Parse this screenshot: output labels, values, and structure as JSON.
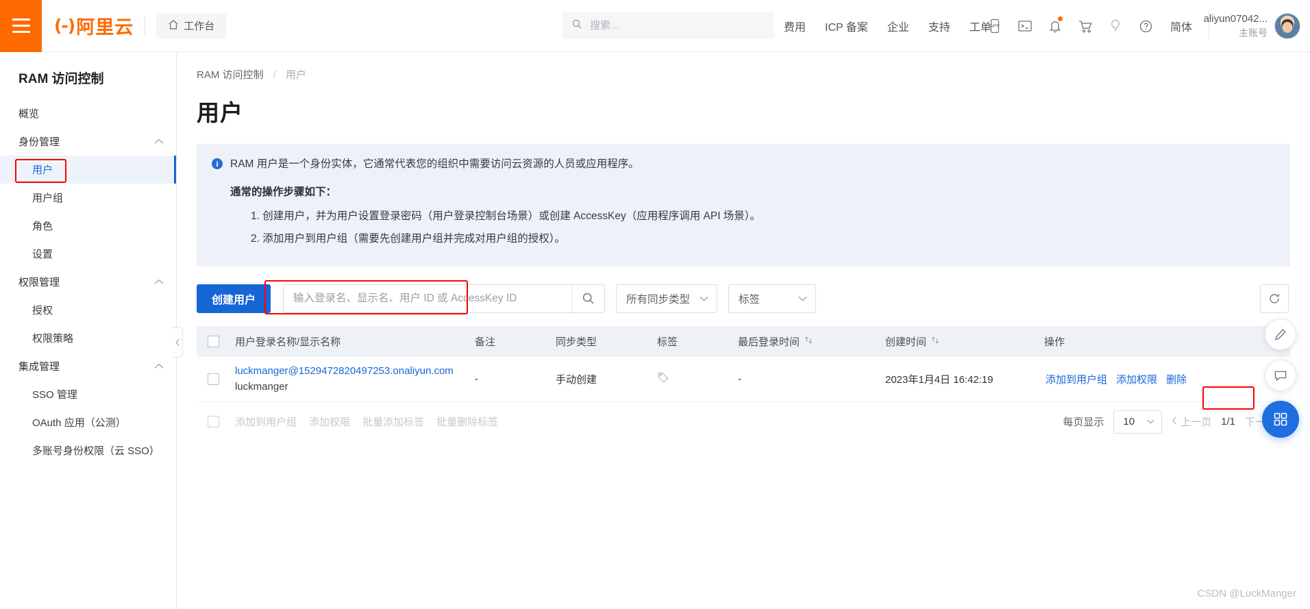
{
  "header": {
    "menu_icon": "hamburger-icon",
    "logo_mark": "(-)",
    "logo_text": "阿里云",
    "workbench_label": "工作台",
    "workbench_icon": "home-icon",
    "search": {
      "placeholder": "搜索...",
      "value": "",
      "icon": "search-icon"
    },
    "nav": [
      {
        "label": "费用"
      },
      {
        "label": "ICP 备案"
      },
      {
        "label": "企业"
      },
      {
        "label": "支持"
      },
      {
        "label": "工单"
      }
    ],
    "icons": [
      {
        "name": "app-icon",
        "glyph": "APP"
      },
      {
        "name": "terminal-icon",
        "glyph": ">_"
      },
      {
        "name": "bell-icon",
        "glyph": "bell",
        "badge": true
      },
      {
        "name": "cart-icon",
        "glyph": "cart"
      },
      {
        "name": "bulb-icon",
        "glyph": "bulb"
      },
      {
        "name": "help-icon",
        "glyph": "?"
      }
    ],
    "language": "简体",
    "account": {
      "name": "aliyun07042...",
      "role": "主账号",
      "avatar": "user-avatar"
    }
  },
  "sidebar": {
    "title": "RAM 访问控制",
    "items": [
      {
        "label": "概览",
        "type": "item",
        "active": false
      },
      {
        "label": "身份管理",
        "type": "group",
        "caret": "chevron-up-icon"
      },
      {
        "label": "用户",
        "type": "sub",
        "active": true,
        "highlighted": true
      },
      {
        "label": "用户组",
        "type": "sub",
        "active": false
      },
      {
        "label": "角色",
        "type": "sub",
        "active": false
      },
      {
        "label": "设置",
        "type": "sub",
        "active": false
      },
      {
        "label": "权限管理",
        "type": "group",
        "caret": "chevron-up-icon"
      },
      {
        "label": "授权",
        "type": "sub",
        "active": false
      },
      {
        "label": "权限策略",
        "type": "sub",
        "active": false
      },
      {
        "label": "集成管理",
        "type": "group",
        "caret": "chevron-up-icon"
      },
      {
        "label": "SSO 管理",
        "type": "sub",
        "active": false
      },
      {
        "label": "OAuth 应用（公测）",
        "type": "sub",
        "active": false
      },
      {
        "label": "多账号身份权限（云 SSO）",
        "type": "sub",
        "active": false
      }
    ],
    "collapse_icon": "chevron-left-icon"
  },
  "breadcrumb": {
    "root": "RAM 访问控制",
    "separator": "/",
    "current": "用户"
  },
  "page_title": "用户",
  "notice": {
    "icon": "info-icon",
    "line1": "RAM 用户是一个身份实体，它通常代表您的组织中需要访问云资源的人员或应用程序。",
    "subtitle": "通常的操作步骤如下：",
    "steps": [
      "1. 创建用户，并为用户设置登录密码（用户登录控制台场景）或创建 AccessKey（应用程序调用 API 场景）。",
      "2. 添加用户到用户组（需要先创建用户组并完成对用户组的授权）。"
    ]
  },
  "toolbar": {
    "create_label": "创建用户",
    "search": {
      "placeholder": "输入登录名、显示名、用户 ID 或 AccessKey ID",
      "value": "",
      "icon": "search-icon",
      "highlighted": true
    },
    "sync_filter": {
      "label": "所有同步类型",
      "icon": "chevron-down-icon"
    },
    "tag_filter": {
      "label": "标签",
      "icon": "chevron-down-icon"
    },
    "refresh_icon": "refresh-icon"
  },
  "table": {
    "columns": [
      {
        "key": "checkbox",
        "label": ""
      },
      {
        "key": "name",
        "label": "用户登录名称/显示名称"
      },
      {
        "key": "note",
        "label": "备注"
      },
      {
        "key": "sync",
        "label": "同步类型"
      },
      {
        "key": "tag",
        "label": "标签"
      },
      {
        "key": "last_login",
        "label": "最后登录时间",
        "sortable": true,
        "sort_icon": "sort-icon"
      },
      {
        "key": "created",
        "label": "创建时间",
        "sortable": true,
        "sort_icon": "sort-icon"
      },
      {
        "key": "ops",
        "label": "操作"
      }
    ],
    "rows": [
      {
        "name": "luckmanger@1529472820497253.onaliyun.com",
        "display_name": "luckmanger",
        "note": "-",
        "sync": "手动创建",
        "tag_icon": "tag-icon",
        "last_login": "-",
        "created": "2023年1月4日 16:42:19",
        "ops": [
          {
            "label": "添加到用户组",
            "highlighted": false
          },
          {
            "label": "添加权限",
            "highlighted": true
          },
          {
            "label": "删除",
            "highlighted": false
          }
        ]
      }
    ]
  },
  "batch_bar": {
    "actions": [
      "添加到用户组",
      "添加权限",
      "批量添加标签",
      "批量删除标签"
    ]
  },
  "pagination": {
    "page_size_label": "每页显示",
    "page_size": "10",
    "page_size_icon": "chevron-down-icon",
    "prev_label": "上一页",
    "prev_icon": "chevron-left-icon",
    "page_indicator": "1/1",
    "next_label": "下一页",
    "next_icon": "chevron-right-icon"
  },
  "rail": [
    {
      "name": "edit-icon",
      "glyph": "pencil",
      "style": "white"
    },
    {
      "name": "feedback-icon",
      "glyph": "chat",
      "style": "white"
    },
    {
      "name": "apps-icon",
      "glyph": "grid",
      "style": "blue"
    }
  ],
  "watermark": "CSDN @LuckManger",
  "colors": {
    "brand_orange": "#ff6a00",
    "link_blue": "#1766d6",
    "primary_button": "#1766d6",
    "highlight_red": "#ff0000",
    "notice_bg": "#eef2f8",
    "table_header_bg": "#eef1f6"
  }
}
